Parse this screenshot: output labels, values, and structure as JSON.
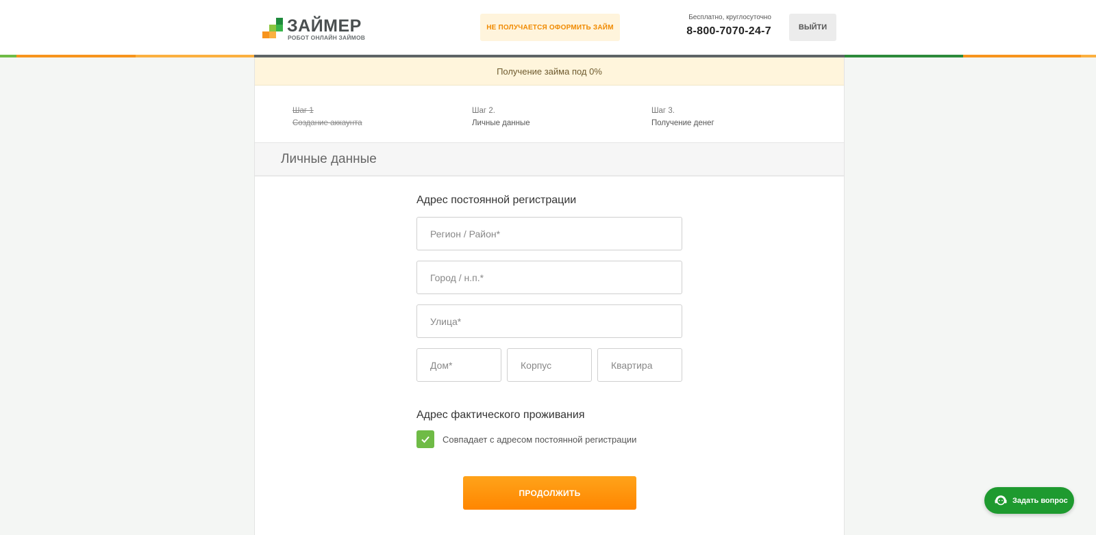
{
  "header": {
    "logo_title": "ЗАЙМЕР",
    "logo_subtitle": "РОБОТ ОНЛАЙН ЗАЙМОВ",
    "help_button": "НЕ ПОЛУЧАЕТСЯ ОФОРМИТЬ ЗАЙМ",
    "phone_note": "Бесплатно, круглосуточно",
    "phone": "8-800-7070-24-7",
    "logout_button": "ВЫЙТИ"
  },
  "promo": "Получение займа под 0%",
  "steps": [
    {
      "num": "Шаг 1",
      "name": "Создание аккаунта",
      "done": true
    },
    {
      "num": "Шаг 2.",
      "name": "Личные данные",
      "done": false
    },
    {
      "num": "Шаг 3.",
      "name": "Получение денег",
      "done": false
    }
  ],
  "section_title": "Личные данные",
  "form": {
    "registration_heading": "Адрес постоянной регистрации",
    "region_placeholder": "Регион / Район*",
    "city_placeholder": "Город / н.п.*",
    "street_placeholder": "Улица*",
    "house_placeholder": "Дом*",
    "building_placeholder": "Корпус",
    "apartment_placeholder": "Квартира",
    "actual_heading": "Адрес фактического проживания",
    "same_address_label": "Совпадает с адресом постоянной регистрации",
    "same_address_checked": true,
    "submit_button": "ПРОДОЛЖИТЬ"
  },
  "chat_button": "Задать вопрос",
  "colors": {
    "accent_orange": "#ff8c00",
    "accent_green": "#6fbb46",
    "chat_green": "#1e9a2f"
  }
}
